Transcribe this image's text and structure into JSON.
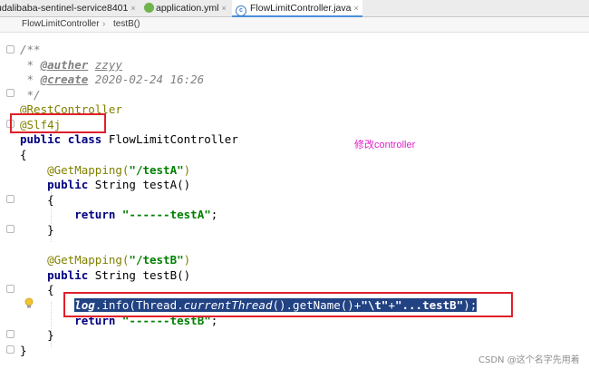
{
  "tabs": [
    {
      "label": "udalibaba-sentinel-service8401",
      "close": "×"
    },
    {
      "label": "application.yml",
      "close": "×"
    },
    {
      "label": "FlowLimitController.java",
      "close": "×"
    }
  ],
  "breadcrumb": {
    "class": "FlowLimitController",
    "separator": "›",
    "method": "testB()"
  },
  "code": {
    "l1": "/**",
    "l2_star": " * ",
    "l2_tag": "@auther",
    "l2_val": "zzyy",
    "l3_star": " * ",
    "l3_tag": "@create",
    "l3_val": "2020-02-24 16:26",
    "l4": " */",
    "l5": "@RestController",
    "l6": "@Slf4j",
    "l7_kw1": "public",
    "l7_kw2": "class",
    "l7_name": " FlowLimitController",
    "l8": "{",
    "l9_ann": "@GetMapping(",
    "l9_str": "\"/testA\"",
    "l9_end": ")",
    "l10_kw": "public",
    "l10_rest": " String testA()",
    "l11": "{",
    "l12_kw": "return",
    "l12_str": "\"------testA\"",
    "l12_end": ";",
    "l13": "}",
    "l14_ann": "@GetMapping(",
    "l14_str": "\"/testB\"",
    "l14_end": ")",
    "l15_kw": "public",
    "l15_rest": " String testB()",
    "l16": "{",
    "l17_log": "log",
    "l17_a": ".info(Thread.",
    "l17_static": "currentThread",
    "l17_b": "().getName()+",
    "l17_s1": "\"\\t\"",
    "l17_plus": "+",
    "l17_s2": "\"...testB\"",
    "l17_end": ");",
    "l18_kw": "return",
    "l18_str": "\"------testB\"",
    "l18_end": ";",
    "l19": "}",
    "l20": "}"
  },
  "note": "修改controller",
  "watermark": "CSDN @这个名字先用着",
  "colors": {
    "selection": "#214283",
    "highlight_box": "#e0202a",
    "note": "#e01fc9",
    "keyword": "#000080",
    "string": "#008000",
    "annotation": "#808000"
  }
}
